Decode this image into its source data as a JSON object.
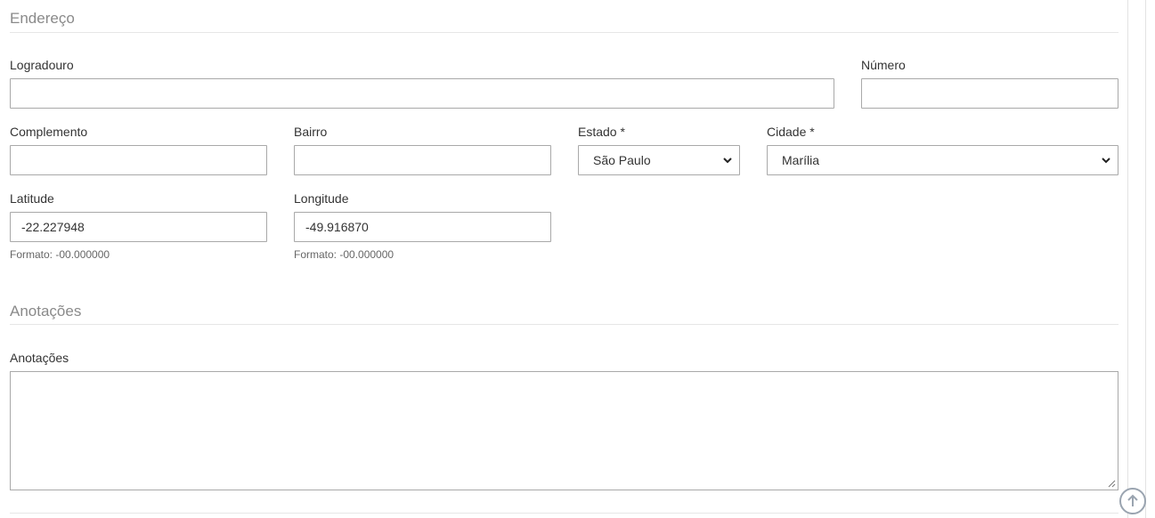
{
  "sections": {
    "endereco": {
      "title": "Endereço"
    },
    "anotacoes": {
      "title": "Anotações"
    }
  },
  "fields": {
    "logradouro": {
      "label": "Logradouro",
      "value": ""
    },
    "numero": {
      "label": "Número",
      "value": ""
    },
    "complemento": {
      "label": "Complemento",
      "value": ""
    },
    "bairro": {
      "label": "Bairro",
      "value": ""
    },
    "estado": {
      "label": "Estado *",
      "value": "São Paulo"
    },
    "cidade": {
      "label": "Cidade *",
      "value": "Marília"
    },
    "latitude": {
      "label": "Latitude",
      "value": "-22.227948",
      "hint": "Formato: -00.000000"
    },
    "longitude": {
      "label": "Longitude",
      "value": "-49.916870",
      "hint": "Formato: -00.000000"
    },
    "anotacoes": {
      "label": "Anotações",
      "value": ""
    }
  },
  "icons": {
    "select_chevron": "chevron-down-icon",
    "scroll_to_top": "arrow-up-circle-icon",
    "resize": "resize-grip-icon"
  }
}
